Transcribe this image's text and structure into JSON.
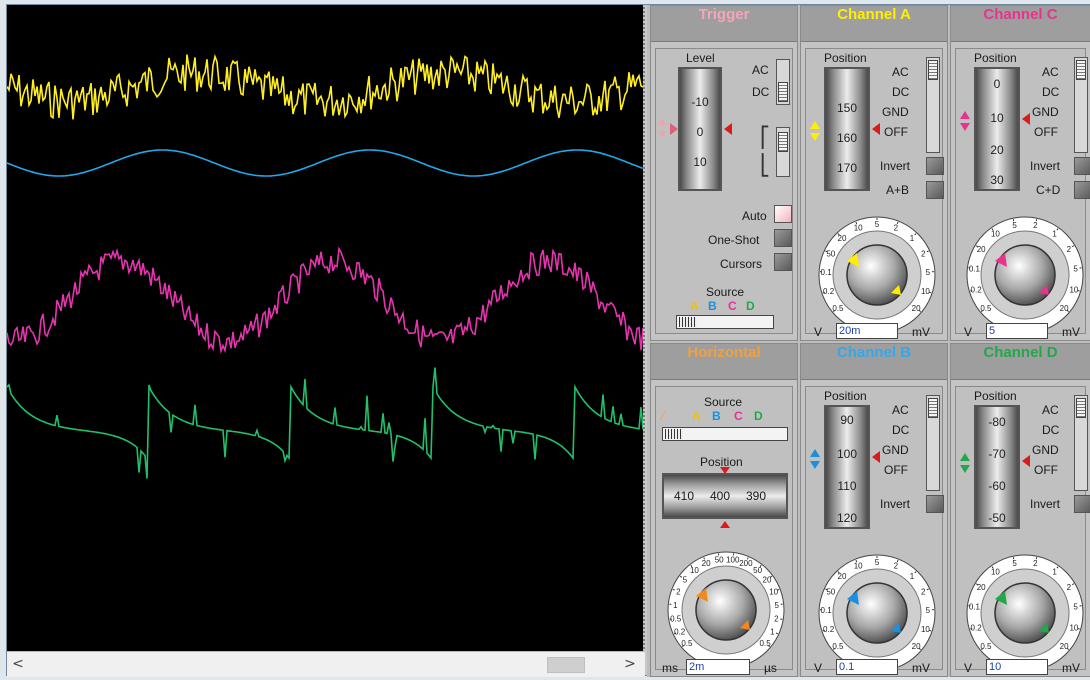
{
  "colors": {
    "trace_a": "#ffee22",
    "trace_b": "#22a7e8",
    "trace_c": "#e833b0",
    "trace_d": "#22c06a",
    "title_trigger": "#f2a6b8",
    "title_channel_a": "#ffee00",
    "title_channel_b": "#35a8e8",
    "title_channel_c": "#e8338d",
    "title_channel_d": "#22a84a",
    "title_horizontal": "#f0a040",
    "screen_bg": "#000000"
  },
  "trigger": {
    "title": "Trigger",
    "level_label": "Level",
    "level_scale": [
      "-10",
      "0",
      "10"
    ],
    "ac": "AC",
    "dc": "DC",
    "auto": "Auto",
    "one_shot": "One-Shot",
    "cursors": "Cursors",
    "source_label": "Source",
    "sources": [
      "A",
      "B",
      "C",
      "D"
    ]
  },
  "channel_a": {
    "title": "Channel A",
    "position_label": "Position",
    "scale": [
      "150",
      "160",
      "170"
    ],
    "ac": "AC",
    "dc": "DC",
    "gnd": "GND",
    "off": "OFF",
    "invert": "Invert",
    "sum": "A+B",
    "dial_ticks": [
      "0.5",
      "0.2",
      "0.1",
      "50",
      "20",
      "10",
      "5",
      "2",
      "1",
      "2",
      "5",
      "10",
      "20"
    ],
    "unit_left": "V",
    "unit_right": "mV",
    "value": "20m"
  },
  "channel_c": {
    "title": "Channel C",
    "position_label": "Position",
    "scale": [
      "0",
      "10",
      "20",
      "30"
    ],
    "ac": "AC",
    "dc": "DC",
    "gnd": "GND",
    "off": "OFF",
    "invert": "Invert",
    "sum": "C+D",
    "dial_ticks": [
      "0.5",
      "0.2",
      "0.1",
      "20",
      "10",
      "5",
      "2",
      "1",
      "2",
      "5",
      "10",
      "20"
    ],
    "unit_left": "V",
    "unit_right": "mV",
    "value": "5"
  },
  "horizontal": {
    "title": "Horizontal",
    "source_label": "Source",
    "sources": [
      "A",
      "B",
      "C",
      "D"
    ],
    "position_label": "Position",
    "position_scale": [
      "410",
      "400",
      "390"
    ],
    "dial_ticks": [
      "0.5",
      "0.2",
      "0.5",
      "1",
      "2",
      "5",
      "10",
      "20",
      "50",
      "100",
      "200",
      "50",
      "20",
      "10",
      "5",
      "2",
      "1",
      "0.5"
    ],
    "unit_left": "ms",
    "unit_right": "µs",
    "value": "2m"
  },
  "channel_b": {
    "title": "Channel B",
    "position_label": "Position",
    "scale": [
      "90",
      "100",
      "110",
      "120"
    ],
    "ac": "AC",
    "dc": "DC",
    "gnd": "GND",
    "off": "OFF",
    "invert": "Invert",
    "dial_ticks": [
      "0.5",
      "0.2",
      "0.1",
      "50",
      "20",
      "10",
      "5",
      "2",
      "1",
      "2",
      "5",
      "10",
      "20"
    ],
    "unit_left": "V",
    "unit_right": "mV",
    "value": "0.1"
  },
  "channel_d": {
    "title": "Channel D",
    "position_label": "Position",
    "scale": [
      "-80",
      "-70",
      "-60",
      "-50"
    ],
    "ac": "AC",
    "dc": "DC",
    "gnd": "GND",
    "off": "OFF",
    "invert": "Invert",
    "dial_ticks": [
      "0.5",
      "0.2",
      "0.1",
      "20",
      "10",
      "5",
      "2",
      "1",
      "2",
      "5",
      "10",
      "20"
    ],
    "unit_left": "V",
    "unit_right": "mV",
    "value": "10"
  },
  "scrollbar": {
    "left_icon": "chevron-left-icon",
    "right_icon": "chevron-right-icon",
    "left": "<",
    "right": ">"
  }
}
